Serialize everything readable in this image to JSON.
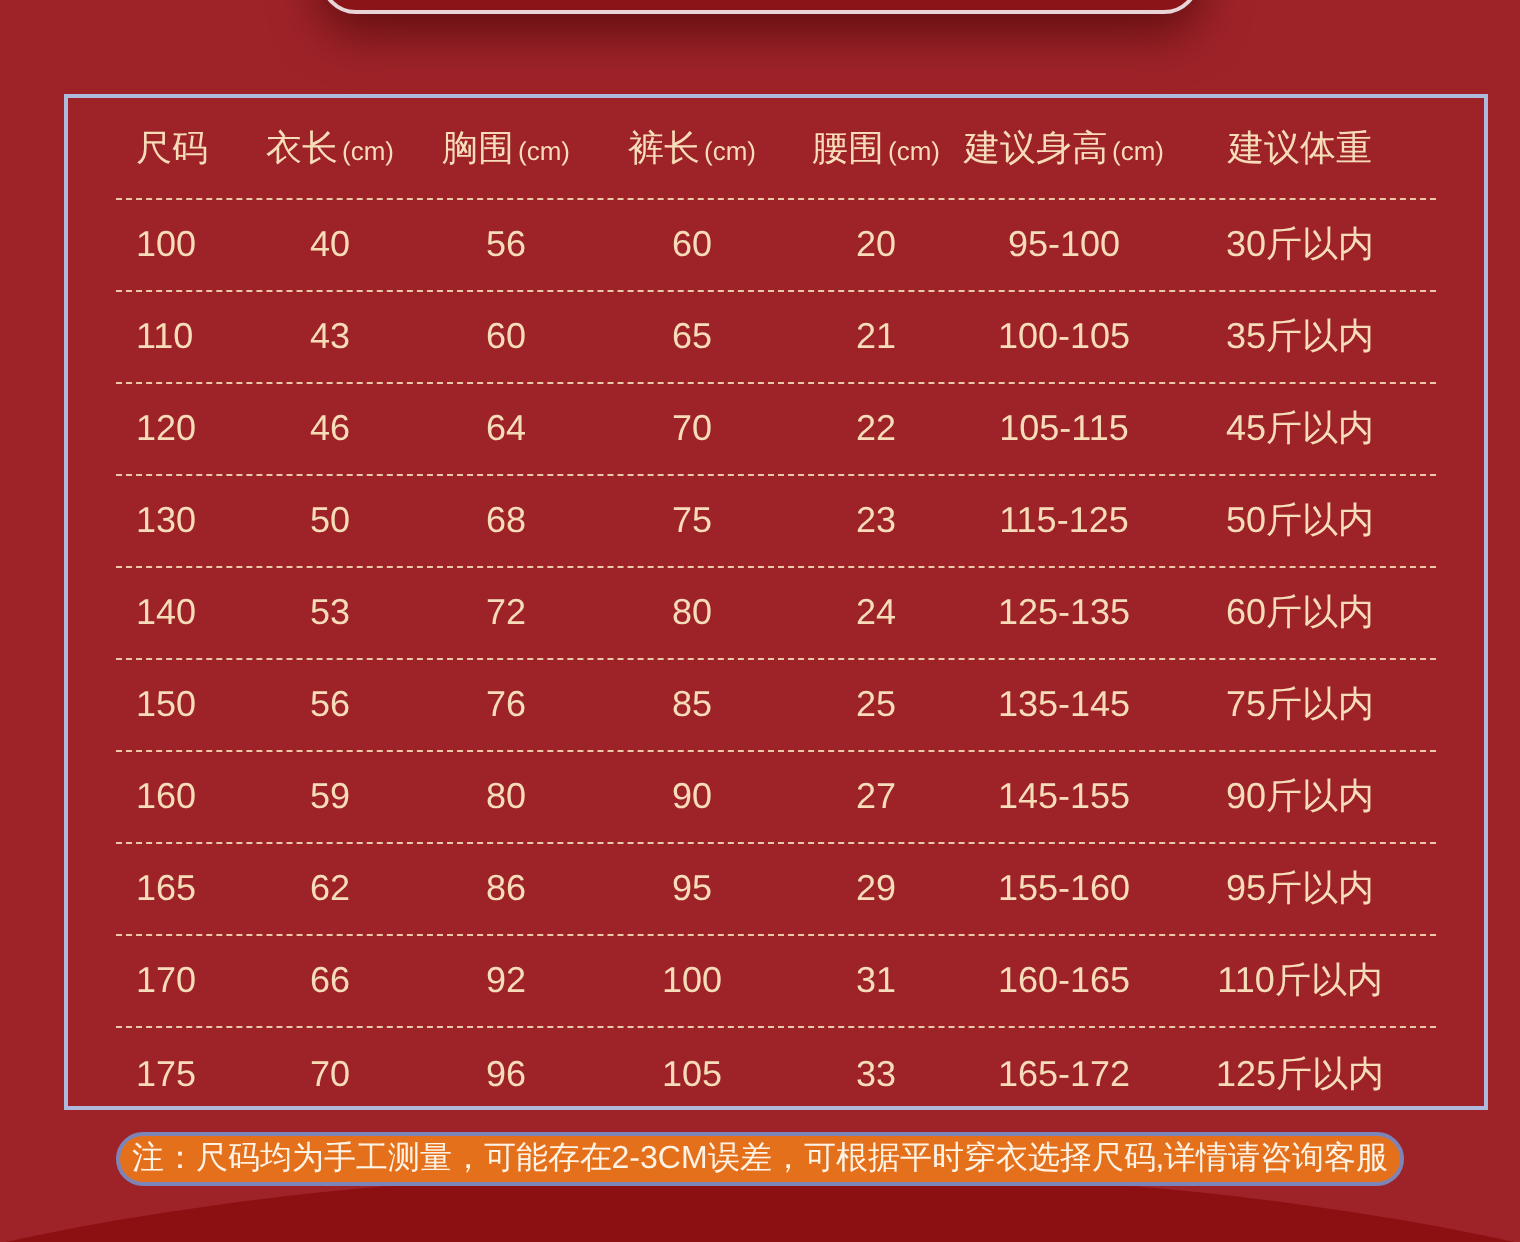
{
  "size_table": {
    "columns": [
      {
        "label": "尺码"
      },
      {
        "label": "衣长",
        "unit": "(cm)"
      },
      {
        "label": "胸围",
        "unit": "(cm)"
      },
      {
        "label": "裤长",
        "unit": "(cm)"
      },
      {
        "label": "腰围",
        "unit": "(cm)"
      },
      {
        "label": "建议身高",
        "unit": "(cm)"
      },
      {
        "label": "建议体重"
      }
    ],
    "rows": [
      [
        "100",
        "40",
        "56",
        "60",
        "20",
        "95-100",
        "30斤以内"
      ],
      [
        "110",
        "43",
        "60",
        "65",
        "21",
        "100-105",
        "35斤以内"
      ],
      [
        "120",
        "46",
        "64",
        "70",
        "22",
        "105-115",
        "45斤以内"
      ],
      [
        "130",
        "50",
        "68",
        "75",
        "23",
        "115-125",
        "50斤以内"
      ],
      [
        "140",
        "53",
        "72",
        "80",
        "24",
        "125-135",
        "60斤以内"
      ],
      [
        "150",
        "56",
        "76",
        "85",
        "25",
        "135-145",
        "75斤以内"
      ],
      [
        "160",
        "59",
        "80",
        "90",
        "27",
        "145-155",
        "90斤以内"
      ],
      [
        "165",
        "62",
        "86",
        "95",
        "29",
        "155-160",
        "95斤以内"
      ],
      [
        "170",
        "66",
        "92",
        "100",
        "31",
        "160-165",
        "110斤以内"
      ],
      [
        "175",
        "70",
        "96",
        "105",
        "33",
        "165-172",
        "125斤以内"
      ]
    ]
  },
  "note": "注：尺码均为手工测量，可能存在2-3CM误差，可根据平时穿衣选择尺码,详情请咨询客服"
}
